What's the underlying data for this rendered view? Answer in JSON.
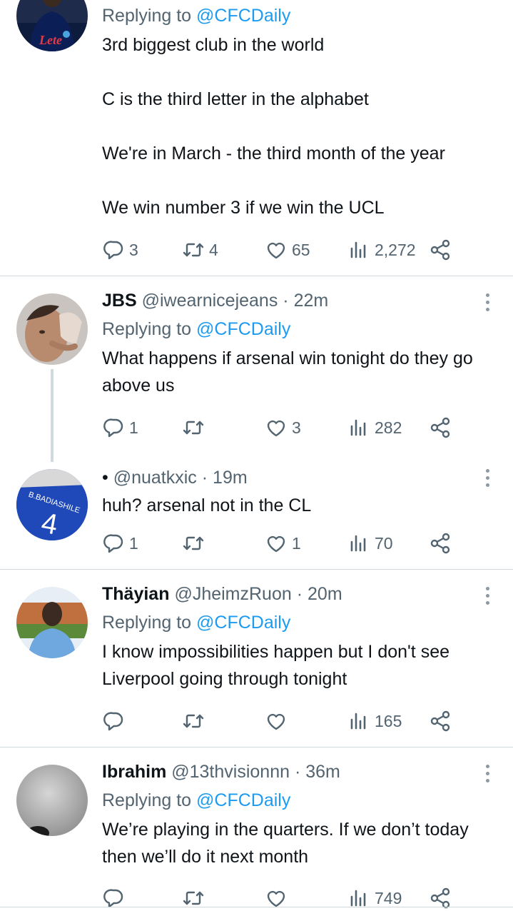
{
  "tweets": [
    {
      "replying_prefix": "Replying to ",
      "replying_handle": "@CFCDaily",
      "text": "3rd biggest club in the world\n\nC is the third letter in the alphabet\n\nWe're in March - the third month of the year\n\nWe win number 3 if we win the UCL",
      "replies": "3",
      "retweets": "4",
      "likes": "65",
      "views": "2,272"
    },
    {
      "name": "JBS",
      "handle": "@iwearnicejeans",
      "time": "· 22m",
      "replying_prefix": "Replying to ",
      "replying_handle": "@CFCDaily",
      "text": "What happens if arsenal win tonight do they go above us",
      "replies": "1",
      "retweets": "",
      "likes": "3",
      "views": "282"
    },
    {
      "name": "•",
      "handle": "@nuatkxic",
      "time": "· 19m",
      "text": "huh? arsenal not in the CL",
      "replies": "1",
      "retweets": "",
      "likes": "1",
      "views": "70"
    },
    {
      "name": "Thäyian",
      "handle": "@JheimzRuon",
      "time": "· 20m",
      "replying_prefix": "Replying to ",
      "replying_handle": "@CFCDaily",
      "text": "I know impossibilities happen but I don't see Liverpool going through tonight",
      "replies": "",
      "retweets": "",
      "likes": "",
      "views": "165"
    },
    {
      "name": "Ibrahim",
      "handle": "@13thvisionnn",
      "time": "· 36m",
      "replying_prefix": "Replying to ",
      "replying_handle": "@CFCDaily",
      "text": "We’re playing in the quarters. If we don’t today then we’ll do it next month",
      "replies": "",
      "retweets": "",
      "likes": "",
      "views": "749"
    }
  ],
  "avatar_texts": {
    "jersey_name": "B.BADIASHILE",
    "jersey_number": "4",
    "shirt_text": "Lete"
  },
  "colors": {
    "link": "#1d9bf0",
    "secondary": "#536471",
    "divider": "#cfd9de",
    "text": "#0f1419"
  },
  "icons": [
    "reply-icon",
    "retweet-icon",
    "like-icon",
    "views-icon",
    "share-icon",
    "more-icon"
  ]
}
